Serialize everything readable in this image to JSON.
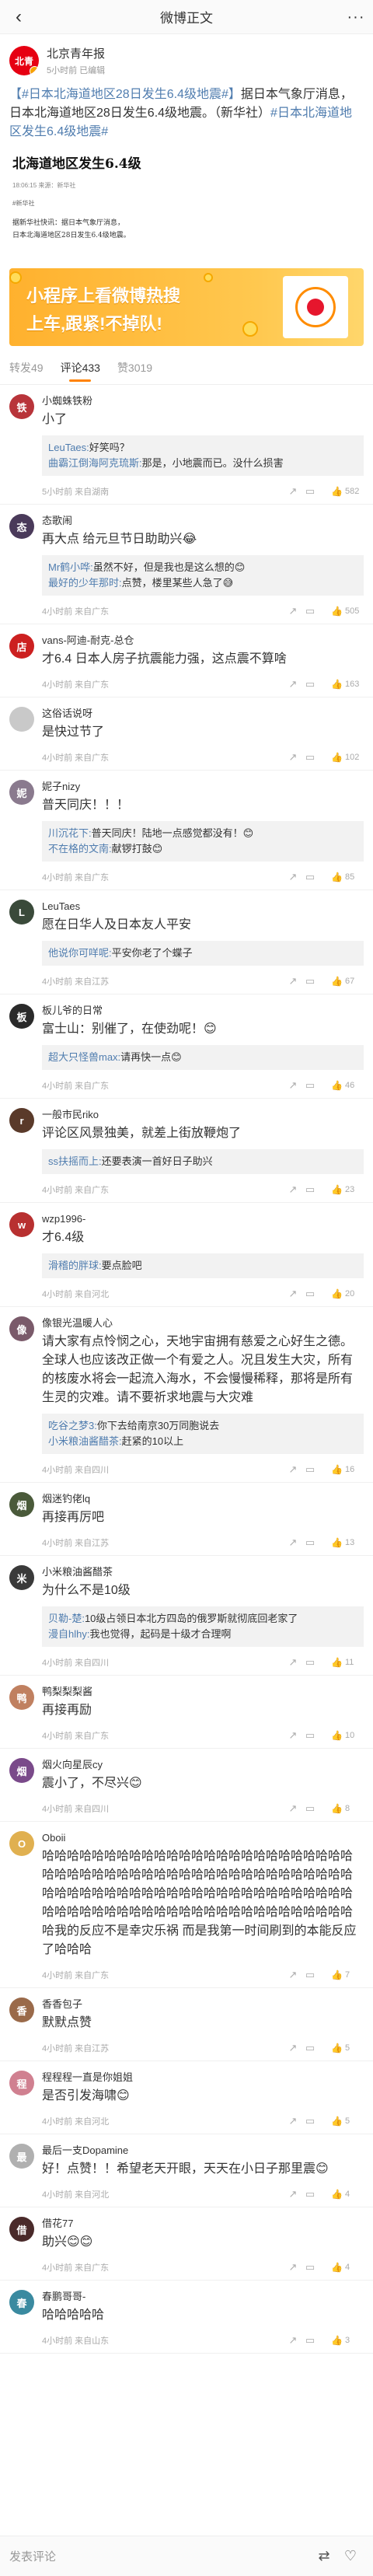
{
  "nav": {
    "back": "‹",
    "title": "微博正文",
    "more": "···"
  },
  "post": {
    "author": "北京青年报",
    "avatar_text": "北青",
    "meta": "5小时前 已编辑",
    "text_parts": [
      {
        "text": "【#日本北海道地区28日发生6.4级地震#】",
        "tag": true
      },
      {
        "text": "据日本气象厅消息，日本北海道地区28日发生6.4级地震。（新华社）",
        "tag": false
      },
      {
        "text": "#日本北海道地区发生6.4级地震#",
        "tag": true
      }
    ]
  },
  "article": {
    "title": "北海道地区发生6.4级",
    "meta": "18:06:15   来源：新华社",
    "source": "#新华社",
    "body": "据新华社快讯：据日本气象厅消息，\n日本北海道地区28日发生6.4级地震。"
  },
  "banner": {
    "line1": "小程序上看微博热搜",
    "line2": "上车,跟紧!不掉队!"
  },
  "tabs": [
    {
      "label": "转发49",
      "active": false
    },
    {
      "label": "评论433",
      "active": true
    },
    {
      "label": "赞3019",
      "active": false
    }
  ],
  "comments": [
    {
      "name": "小蜘蛛铁粉",
      "text": "小了",
      "color": "#b8343a",
      "av": "铁",
      "replies": [
        {
          "n": "LeuTaes:",
          "t": "好笑吗？"
        },
        {
          "n": "曲霸江倒海阿克琉斯:",
          "t": "那是，小地震而已。没什么损害"
        }
      ],
      "meta": "5小时前 来自湖南",
      "likes": "582"
    },
    {
      "name": "态歌闹",
      "text": "再大点 给元旦节日助助兴😂",
      "color": "#4a3a5a",
      "av": "态",
      "replies": [
        {
          "n": "Mr鹤小哗:",
          "t": "虽然不好，但是我也是这么想的😊"
        },
        {
          "n": "最好的少年那时:",
          "t": "点赞，楼里某些人急了😅"
        }
      ],
      "meta": "4小时前 来自广东",
      "likes": "505"
    },
    {
      "name": "vans-阿迪-耐克-总仓",
      "text": "才6.4 日本人房子抗震能力强，这点震不算啥",
      "color": "#cc2020",
      "av": "店",
      "replies": [],
      "meta": "4小时前 来自广东",
      "likes": "163"
    },
    {
      "name": "这俗话说呀",
      "text": "是快过节了",
      "color": "#c9c9c9",
      "av": "",
      "replies": [],
      "meta": "4小时前 来自广东",
      "likes": "102"
    },
    {
      "name": "妮子nizy",
      "text": "普天同庆！！！",
      "color": "#8a7a8e",
      "av": "妮",
      "replies": [
        {
          "n": "川沉花下:",
          "t": "普天同庆！陆地一点感觉都没有！😊"
        },
        {
          "n": "不在格的文南:",
          "t": "献锣打鼓😊"
        }
      ],
      "meta": "4小时前 来自广东",
      "likes": "85"
    },
    {
      "name": "LeuTaes",
      "text": "愿在日华人及日本友人平安",
      "color": "#3a4a3a",
      "av": "L",
      "replies": [
        {
          "n": "他说你可咩呢:",
          "t": "平安你老了个蝶子"
        }
      ],
      "meta": "4小时前 来自江苏",
      "likes": "67"
    },
    {
      "name": "板儿爷的日常",
      "text": "富士山：别催了，在使劲呢！😊",
      "color": "#2a2a2a",
      "av": "板",
      "replies": [
        {
          "n": "超大只怪兽max:",
          "t": "请再快一点😊"
        }
      ],
      "meta": "4小时前 来自广东",
      "likes": "46"
    },
    {
      "name": "一般市民riko",
      "text": "评论区风景独美，就差上街放鞭炮了",
      "color": "#5a3a2a",
      "av": "r",
      "replies": [
        {
          "n": "ss扶摇而上:",
          "t": "还要表演一首好日子助兴"
        }
      ],
      "meta": "4小时前 来自广东",
      "likes": "23"
    },
    {
      "name": "wzp1996-",
      "text": "才6.4级",
      "color": "#b83030",
      "av": "w",
      "replies": [
        {
          "n": "滑稽的胖球:",
          "t": "要点脸吧"
        }
      ],
      "meta": "4小时前 来自河北",
      "likes": "20"
    },
    {
      "name": "像银光温暖人心",
      "text": "请大家有点怜悯之心，天地宇宙拥有慈爱之心好生之德。全球人也应该改正做一个有爱之人。况且发生大灾，所有的核废水将会一起流入海水，不会慢慢稀释，那将是所有生灵的灾难。请不要祈求地震与大灾难",
      "color": "#7a5a6a",
      "av": "像",
      "replies": [
        {
          "n": "吃谷之梦3:",
          "t": "你下去给南京30万同胞说去"
        },
        {
          "n": "小米粮油酱醋茶:",
          "t": "赶紧的10以上"
        }
      ],
      "meta": "4小时前 来自四川",
      "likes": "16"
    },
    {
      "name": "烟迷钓佬lq",
      "text": "再接再厉吧",
      "color": "#4a5a3a",
      "av": "烟",
      "replies": [],
      "meta": "4小时前 来自江苏",
      "likes": "13"
    },
    {
      "name": "小米粮油酱醋茶",
      "text": "为什么不是10级",
      "color": "#3a3a3a",
      "av": "米",
      "replies": [
        {
          "n": "贝勒-楚:",
          "t": "10级占领日本北方四岛的俄罗斯就彻底回老家了"
        },
        {
          "n": "漫自hlhy:",
          "t": "我也觉得，起码是十级才合理啊"
        }
      ],
      "meta": "4小时前 来自四川",
      "likes": "11"
    },
    {
      "name": "鸭梨梨梨酱",
      "text": "再接再励",
      "color": "#c08060",
      "av": "鸭",
      "replies": [],
      "meta": "4小时前 来自广东",
      "likes": "10"
    },
    {
      "name": "烟火向星辰cy",
      "text": "震小了，不尽兴😊",
      "color": "#7a4a8a",
      "av": "烟",
      "replies": [],
      "meta": "4小时前 来自四川",
      "likes": "8"
    },
    {
      "name": "Oboii",
      "text": "哈哈哈哈哈哈哈哈哈哈哈哈哈哈哈哈哈哈哈哈哈哈哈哈哈哈哈哈哈哈哈哈哈哈哈哈哈哈哈哈哈哈哈哈哈哈哈哈哈哈哈哈哈哈哈哈哈哈哈哈哈哈哈哈哈哈哈哈哈哈哈哈哈哈哈哈哈哈哈哈哈哈哈哈哈哈哈哈哈哈哈哈哈哈哈哈哈哈哈哈哈我的反应不是幸灾乐祸 而是我第一时间刷到的本能反应了哈哈哈",
      "color": "#e0b050",
      "av": "O",
      "replies": [],
      "meta": "4小时前 来自广东",
      "likes": "7"
    },
    {
      "name": "香香包子",
      "text": "默默点赞",
      "color": "#9a6a4a",
      "av": "香",
      "replies": [],
      "meta": "4小时前 来自江苏",
      "likes": "5"
    },
    {
      "name": "程程程一直是你姐姐",
      "text": "是否引发海啸😊",
      "color": "#d08090",
      "av": "程",
      "replies": [],
      "meta": "4小时前 来自河北",
      "likes": "5"
    },
    {
      "name": "最后一支Dopamine",
      "text": "好！点赞！！希望老天开眼，天天在小日子那里震😊",
      "color": "#b0b0b0",
      "av": "最",
      "replies": [],
      "meta": "4小时前 来自河北",
      "likes": "4"
    },
    {
      "name": "借花77",
      "text": "助兴😊😊",
      "color": "#4a2a2a",
      "av": "借",
      "replies": [],
      "meta": "4小时前 来自广东",
      "likes": "4"
    },
    {
      "name": "春鹏哥哥-",
      "text": "哈哈哈哈哈",
      "color": "#3a8aa0",
      "av": "春",
      "replies": [],
      "meta": "4小时前 来自山东",
      "likes": "3"
    }
  ],
  "bottombar": {
    "placeholder": "发表评论",
    "icons": [
      "repost-icon",
      "like-icon"
    ]
  }
}
